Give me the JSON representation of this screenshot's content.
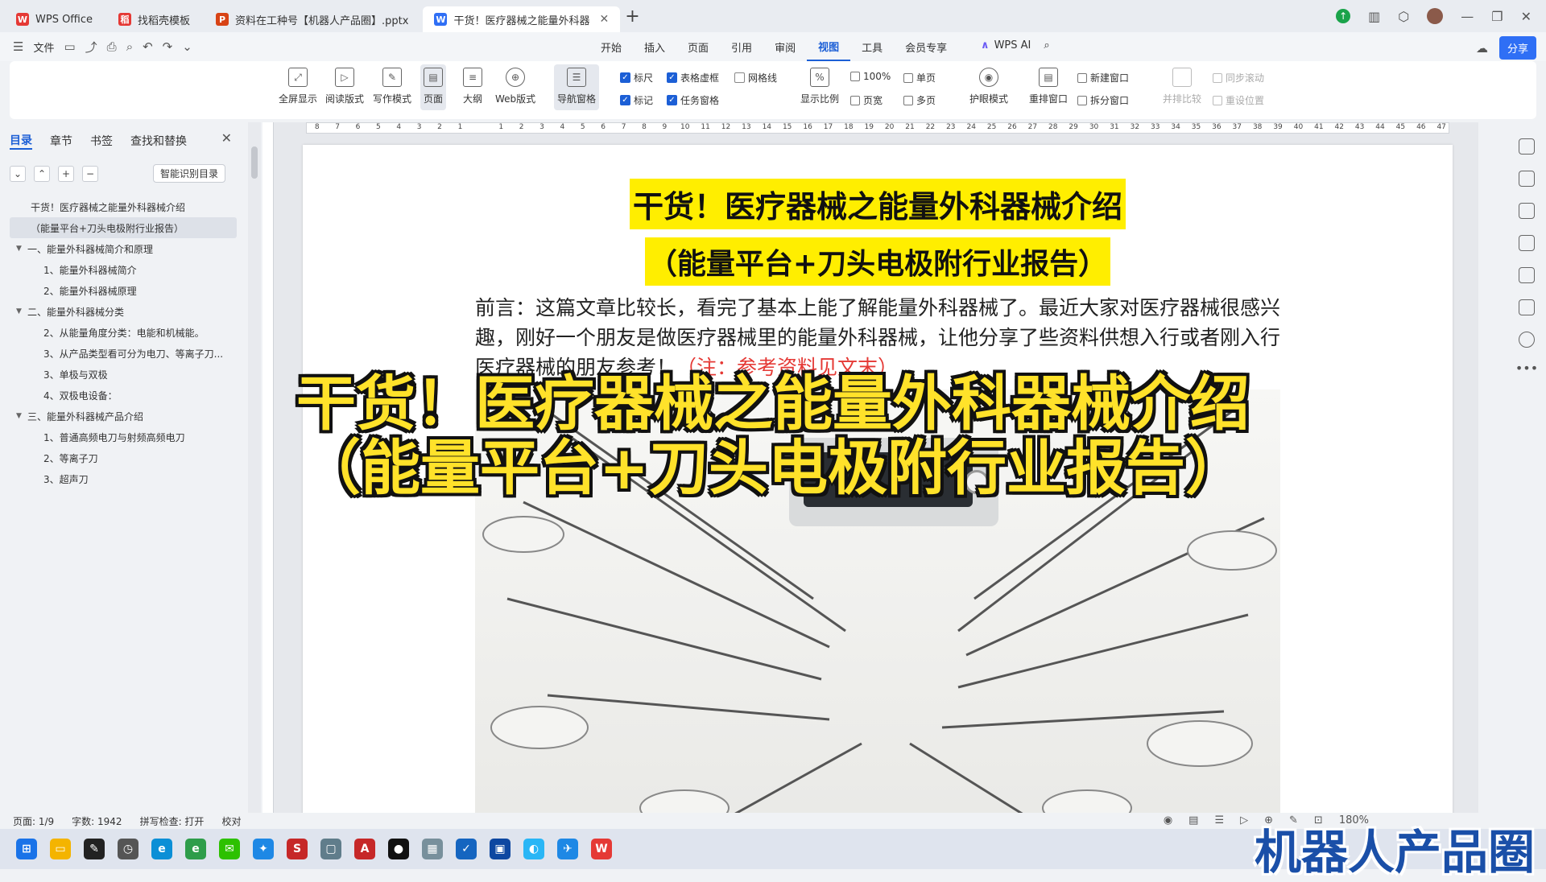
{
  "tabs": [
    {
      "label": "WPS Office",
      "icon": "W",
      "color": "#e53935",
      "active": false
    },
    {
      "label": "找稻壳模板",
      "icon": "稻",
      "color": "#e53935",
      "active": false
    },
    {
      "label": "资料在工种号【机器人产品圈】.pptx",
      "icon": "P",
      "color": "#d84315",
      "active": false
    },
    {
      "label": "干货！医疗器械之能量外科器",
      "icon": "W",
      "color": "#2f6ff5",
      "active": true
    }
  ],
  "menu": {
    "file": "文件",
    "tabs": [
      "开始",
      "插入",
      "页面",
      "引用",
      "审阅",
      "视图",
      "工具",
      "会员专享"
    ],
    "active_tab": "视图",
    "wps_ai": "WPS AI",
    "share": "分享"
  },
  "ribbon": {
    "buttons": [
      "全屏显示",
      "阅读版式",
      "写作模式",
      "页面",
      "大纲",
      "Web版式",
      "导航窗格"
    ],
    "checks": [
      {
        "label": "标尺",
        "on": true
      },
      {
        "label": "表格虚框",
        "on": true
      },
      {
        "label": "网格线",
        "on": false
      },
      {
        "label": "标记",
        "on": true
      },
      {
        "label": "任务窗格",
        "on": true
      }
    ],
    "zoom_label": "显示比例",
    "zoom_100": "100%",
    "page_width": "页宽",
    "single_page": "单页",
    "multi_page": "多页",
    "eye_mode": "护眼模式",
    "rearrange": "重排窗口",
    "new_window": "新建窗口",
    "split_window": "拆分窗口",
    "side_by_side": "并排比较",
    "sync_scroll": "同步滚动",
    "reset_pos": "重设位置"
  },
  "sidepanel": {
    "tabs": [
      "目录",
      "章节",
      "书签",
      "查找和替换"
    ],
    "active_tab": "目录",
    "smart_btn": "智能识别目录",
    "toc": [
      {
        "text": "干货！医疗器械之能量外科器械介绍",
        "level": 1,
        "arrow": ""
      },
      {
        "text": "（能量平台+刀头电极附行业报告）",
        "level": 1,
        "arrow": "",
        "selected": true
      },
      {
        "text": "一、能量外科器械简介和原理",
        "level": 1,
        "arrow": "▼"
      },
      {
        "text": "1、能量外科器械简介",
        "level": 2,
        "arrow": ""
      },
      {
        "text": "2、能量外科器械原理",
        "level": 2,
        "arrow": ""
      },
      {
        "text": "二、能量外科器械分类",
        "level": 1,
        "arrow": "▼"
      },
      {
        "text": "2、从能量角度分类：电能和机械能。",
        "level": 2,
        "arrow": ""
      },
      {
        "text": "3、从产品类型看可分为电刀、等离子刀...",
        "level": 2,
        "arrow": ""
      },
      {
        "text": "3、单极与双极",
        "level": 2,
        "arrow": ""
      },
      {
        "text": "4、双极电设备：",
        "level": 2,
        "arrow": ""
      },
      {
        "text": "三、能量外科器械产品介绍",
        "level": 1,
        "arrow": "▼"
      },
      {
        "text": "1、普通高频电刀与射频高频电刀",
        "level": 2,
        "arrow": ""
      },
      {
        "text": "2、等离子刀",
        "level": 2,
        "arrow": ""
      },
      {
        "text": "3、超声刀",
        "level": 2,
        "arrow": ""
      }
    ]
  },
  "ruler_ticks": [
    "8",
    "7",
    "6",
    "5",
    "4",
    "3",
    "2",
    "1",
    "",
    "1",
    "2",
    "3",
    "4",
    "5",
    "6",
    "7",
    "8",
    "9",
    "10",
    "11",
    "12",
    "13",
    "14",
    "15",
    "16",
    "17",
    "18",
    "19",
    "20",
    "21",
    "22",
    "23",
    "24",
    "25",
    "26",
    "27",
    "28",
    "29",
    "30",
    "31",
    "32",
    "33",
    "34",
    "35",
    "36",
    "37",
    "38",
    "39",
    "40",
    "41",
    "42",
    "43",
    "44",
    "45",
    "46",
    "47"
  ],
  "document": {
    "title1": "干货！医疗器械之能量外科器械介绍",
    "title2": "（能量平台+刀头电极附行业报告）",
    "preface_main": "前言：这篇文章比较长，看完了基本上能了解能量外科器械了。最近大家对医疗器械很感兴趣，刚好一个朋友是做医疗器械里的能量外科器械，让他分享了些资料供想入行或者刚入行医疗器械的朋友参考！",
    "preface_note": "（注：参考资料见文末）"
  },
  "overlay": {
    "line1": "干货！医疗器械之能量外科器械介绍",
    "line2": "（能量平台+刀头电极附行业报告）"
  },
  "status": {
    "page": "页面: 1/9",
    "words": "字数: 1942",
    "spell": "拼写检查: 打开",
    "proof": "校对",
    "zoom": "180%"
  },
  "watermark": "机器人产品圈"
}
